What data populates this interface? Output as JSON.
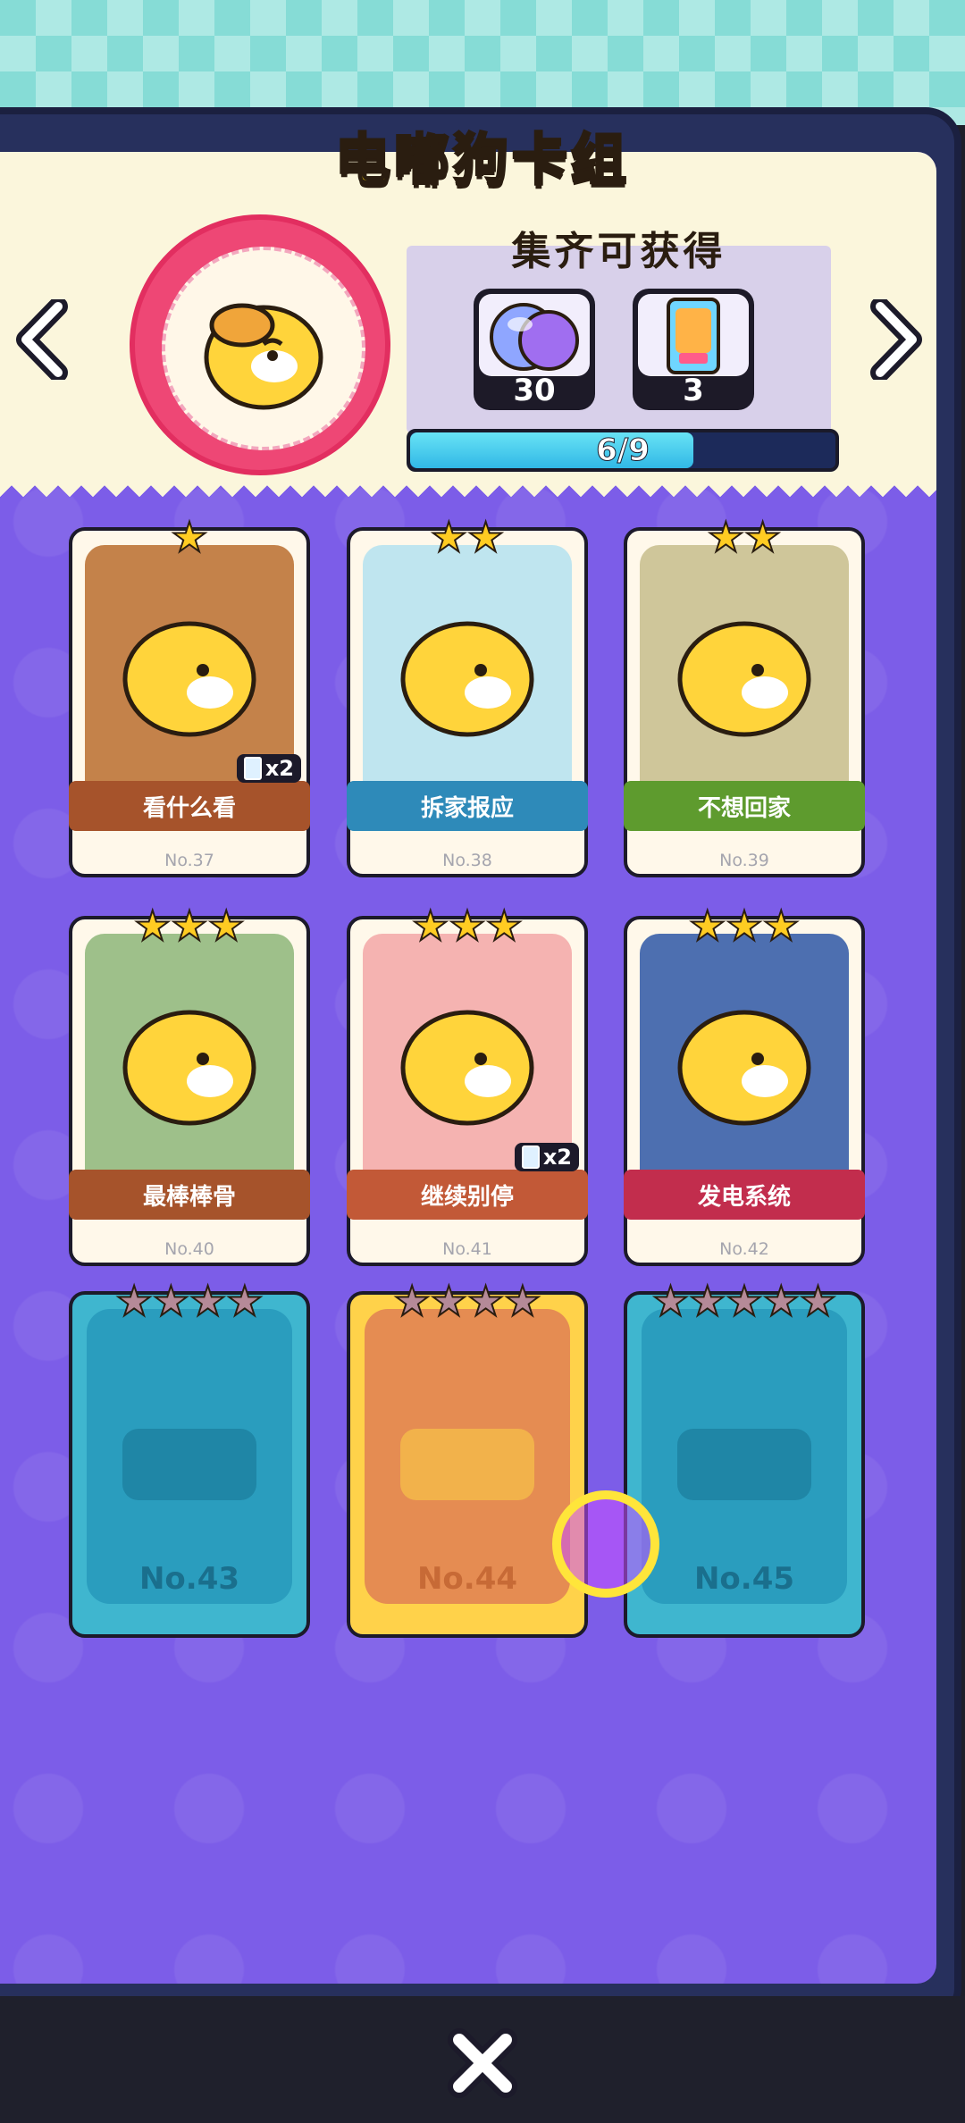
{
  "title": "电嘟狗卡组",
  "reward": {
    "heading": "集齐可获得",
    "items": [
      {
        "icon": "capsule-egg-icon",
        "count": "30"
      },
      {
        "icon": "card-pack-icon",
        "count": "3"
      }
    ],
    "progress_text": "6/9",
    "progress_fraction": 0.6667
  },
  "cards": [
    {
      "name": "看什么看",
      "number": "No.37",
      "stars": 1,
      "banner_color": "#a6532b",
      "art_color": "#c4824a",
      "dup": "x2"
    },
    {
      "name": "拆家报应",
      "number": "No.38",
      "stars": 2,
      "banner_color": "#2e8ab9",
      "art_color": "#bfe5ef",
      "dup": ""
    },
    {
      "name": "不想回家",
      "number": "No.39",
      "stars": 2,
      "banner_color": "#5e9b2e",
      "art_color": "#cfc69a",
      "dup": ""
    },
    {
      "name": "最棒棒骨",
      "number": "No.40",
      "stars": 3,
      "banner_color": "#a6532b",
      "art_color": "#9ec08a",
      "dup": ""
    },
    {
      "name": "继续别停",
      "number": "No.41",
      "stars": 3,
      "banner_color": "#c25937",
      "art_color": "#f5b3b1",
      "dup": "x2"
    },
    {
      "name": "发电系统",
      "number": "No.42",
      "stars": 3,
      "banner_color": "#c22d4d",
      "art_color": "#4d6fb0",
      "dup": ""
    }
  ],
  "locked": [
    {
      "number": "No.43",
      "stars": 4,
      "theme": "blue"
    },
    {
      "number": "No.44",
      "stars": 4,
      "theme": "orange"
    },
    {
      "number": "No.45",
      "stars": 5,
      "theme": "blue"
    }
  ]
}
